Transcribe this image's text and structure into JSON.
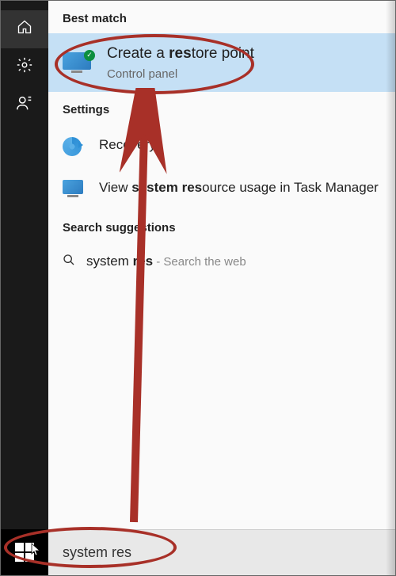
{
  "sidebar": {
    "icons": [
      "home",
      "settings",
      "feedback"
    ]
  },
  "bestMatch": {
    "header": "Best match",
    "title": "Create a restore point",
    "highlight": "res",
    "subtitle": "Control panel"
  },
  "settings": {
    "header": "Settings",
    "items": [
      {
        "text": "Recovery"
      },
      {
        "prefix": "View ",
        "highlight": "system res",
        "suffix": "ource usage in Task Manager"
      }
    ]
  },
  "suggestions": {
    "header": "Search suggestions",
    "query_prefix": "system ",
    "query_highlight": "res",
    "tail": " - Search the web"
  },
  "search": {
    "value": "system res"
  },
  "annotations": {
    "arrow_color": "#a83028"
  }
}
